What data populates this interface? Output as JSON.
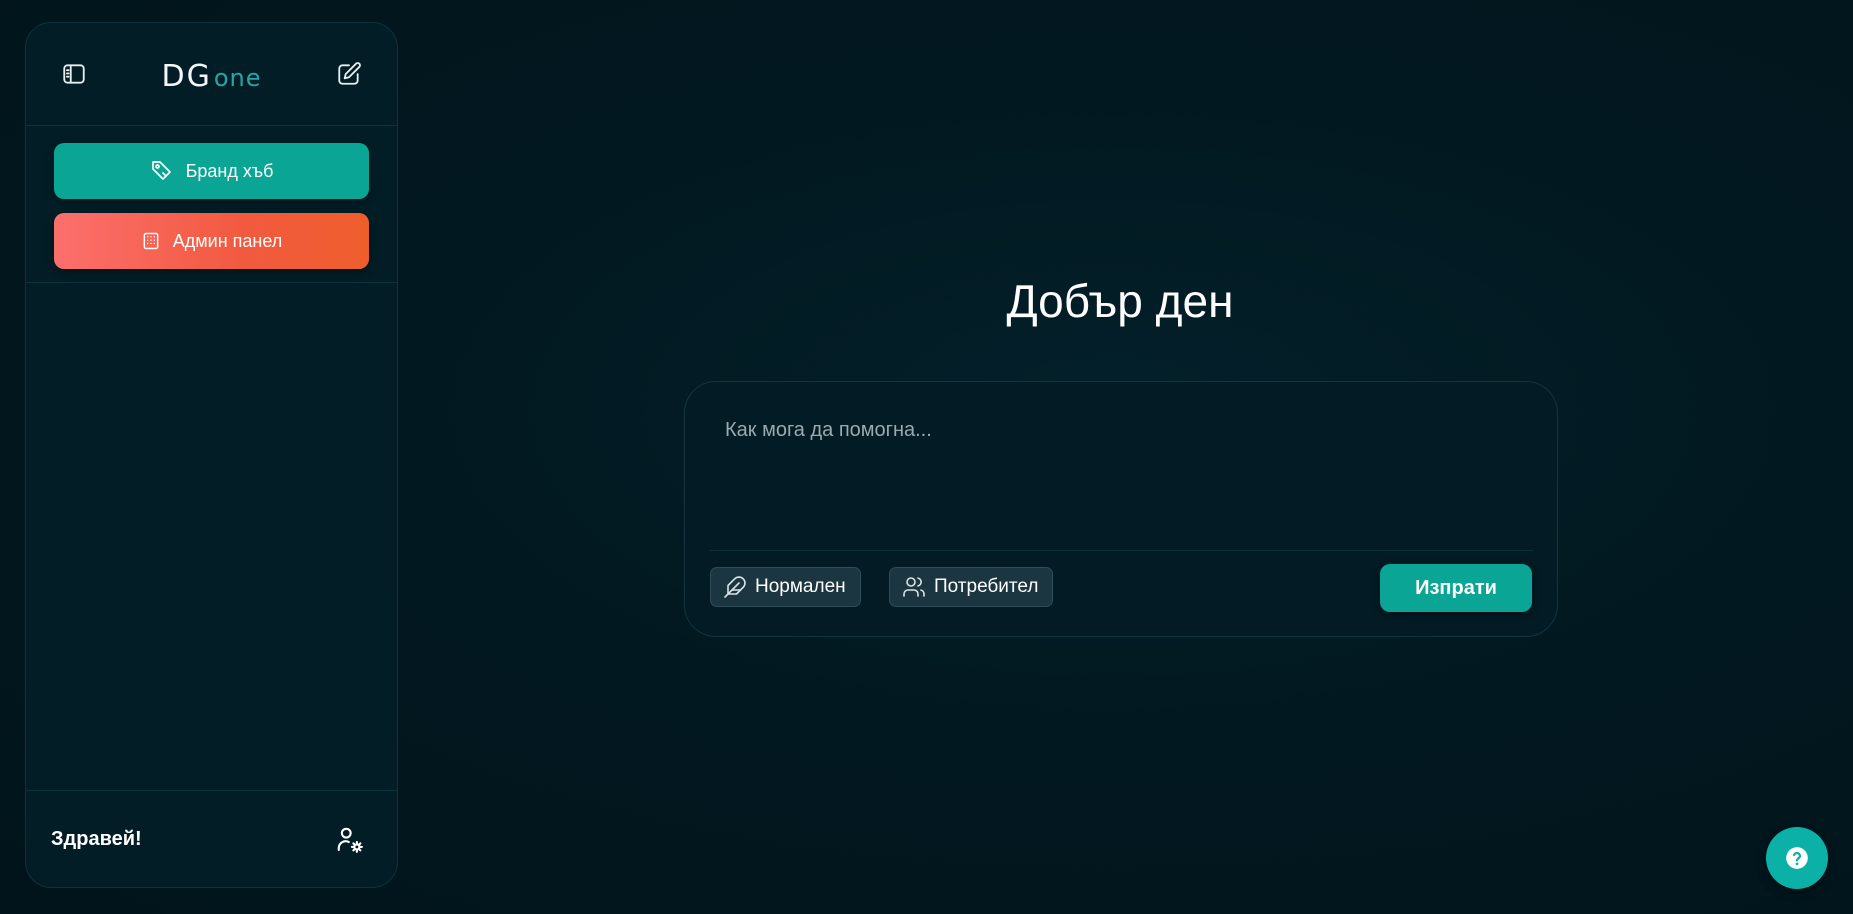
{
  "sidebar": {
    "toggle_icon": "sidebar-toggle-icon",
    "new_chat_icon": "edit-icon",
    "logo": {
      "part1": "DG",
      "part2": "one"
    },
    "brand_hub_label": "Бранд хъб",
    "brand_hub_icon": "tag-icon",
    "admin_panel_label": "Админ панел",
    "admin_panel_icon": "building-icon",
    "greeting": "Здравей!",
    "user_settings_icon": "user-settings-icon"
  },
  "main": {
    "title": "Добър ден",
    "prompt": {
      "placeholder": "Как мога да помогна...",
      "value": ""
    },
    "mode_chip_label": "Нормален",
    "mode_chip_icon": "feather-icon",
    "audience_chip_label": "Потребител",
    "audience_chip_icon": "users-icon",
    "send_label": "Изпрати"
  },
  "help": {
    "icon": "help-icon"
  },
  "colors": {
    "background": "#01161d",
    "sidebar": "#021d26",
    "accent_teal": "#0aa594",
    "admin_gradient_start": "#fc6f6d",
    "admin_gradient_end": "#ee5e2c",
    "logo_accent": "#25a6a6"
  }
}
